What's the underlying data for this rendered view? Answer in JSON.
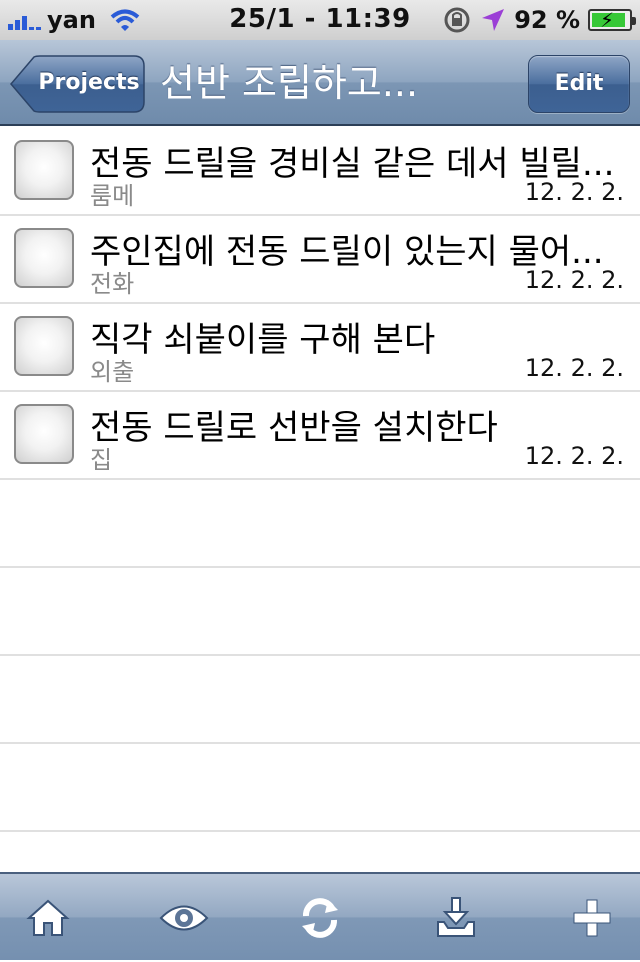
{
  "status_bar": {
    "carrier": "yan",
    "time": "25/1 - 11:39",
    "battery_percent": "92 %",
    "battery_level": 0.92
  },
  "nav": {
    "back_label": "Projects",
    "title": "선반 조립하고...",
    "edit_label": "Edit"
  },
  "items": [
    {
      "title": "전동 드릴을 경비실 같은 데서 빌릴...",
      "context": "룸메",
      "date": "12. 2. 2."
    },
    {
      "title": "주인집에 전동 드릴이 있는지 물어...",
      "context": "전화",
      "date": "12. 2. 2."
    },
    {
      "title": "직각 쇠붙이를 구해 본다",
      "context": "외출",
      "date": "12. 2. 2."
    },
    {
      "title": "전동 드릴로 선반을 설치한다",
      "context": "집",
      "date": "12. 2. 2."
    }
  ],
  "toolbar": {
    "icons": [
      "home-icon",
      "eye-icon",
      "sync-icon",
      "inbox-download-icon",
      "plus-icon"
    ]
  },
  "colors": {
    "nav_bar": "#8ea5c0",
    "toolbar": "#93a8c2",
    "signal": "#2a5bd7",
    "battery_fill": "#37c837",
    "location_arrow": "#9b3fd6"
  }
}
